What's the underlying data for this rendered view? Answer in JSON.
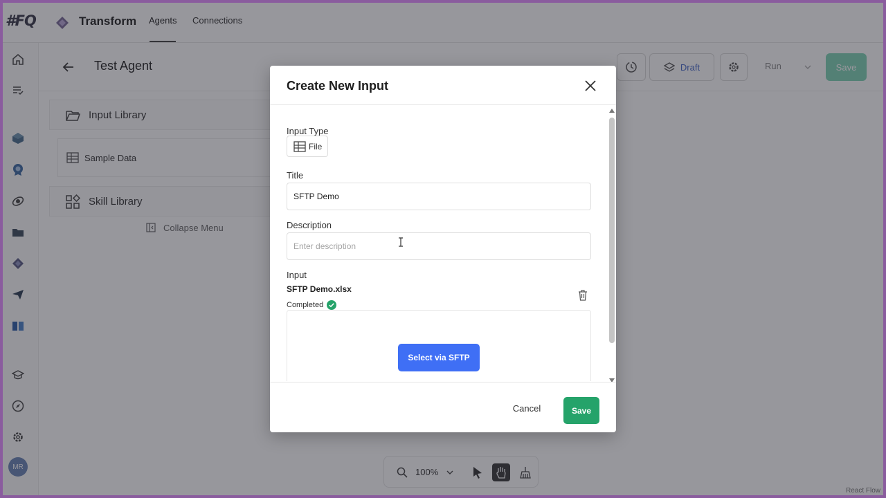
{
  "app": {
    "logo_text": "#FQ",
    "brand_name": "Transform",
    "nav_tabs": [
      {
        "label": "Agents",
        "active": true
      },
      {
        "label": "Connections",
        "active": false
      }
    ]
  },
  "sidebar": {
    "icons": [
      "home-icon",
      "list-check-icon",
      "cube-icon",
      "badge-icon",
      "orbit-icon",
      "folder-icon",
      "gem-icon",
      "send-icon",
      "book-icon",
      "cap-icon",
      "compass-icon",
      "gear-icon"
    ],
    "avatar_initials": "MR"
  },
  "agent_header": {
    "title": "Test Agent",
    "draft_label": "Draft",
    "run_label": "Run",
    "save_label": "Save"
  },
  "library_panel": {
    "input_library": "Input Library",
    "sample_data": "Sample Data",
    "skill_library": "Skill Library",
    "collapse_menu": "Collapse Menu"
  },
  "zoom": {
    "level": "100%"
  },
  "attribution": "React Flow",
  "modal": {
    "title": "Create New Input",
    "input_type_label": "Input Type",
    "input_type_value": "File",
    "title_label": "Title",
    "title_value": "SFTP Demo",
    "description_label": "Description",
    "description_placeholder": "Enter description",
    "input_label": "Input",
    "file_name": "SFTP Demo.xlsx",
    "file_status": "Completed",
    "select_sftp_label": "Select via SFTP",
    "cancel_label": "Cancel",
    "save_label": "Save"
  },
  "colors": {
    "primary": "#3f6ff5",
    "success": "#25a36a",
    "overlay": "rgba(35,35,45,0.47)",
    "frame_border": "#8a5c9e"
  }
}
